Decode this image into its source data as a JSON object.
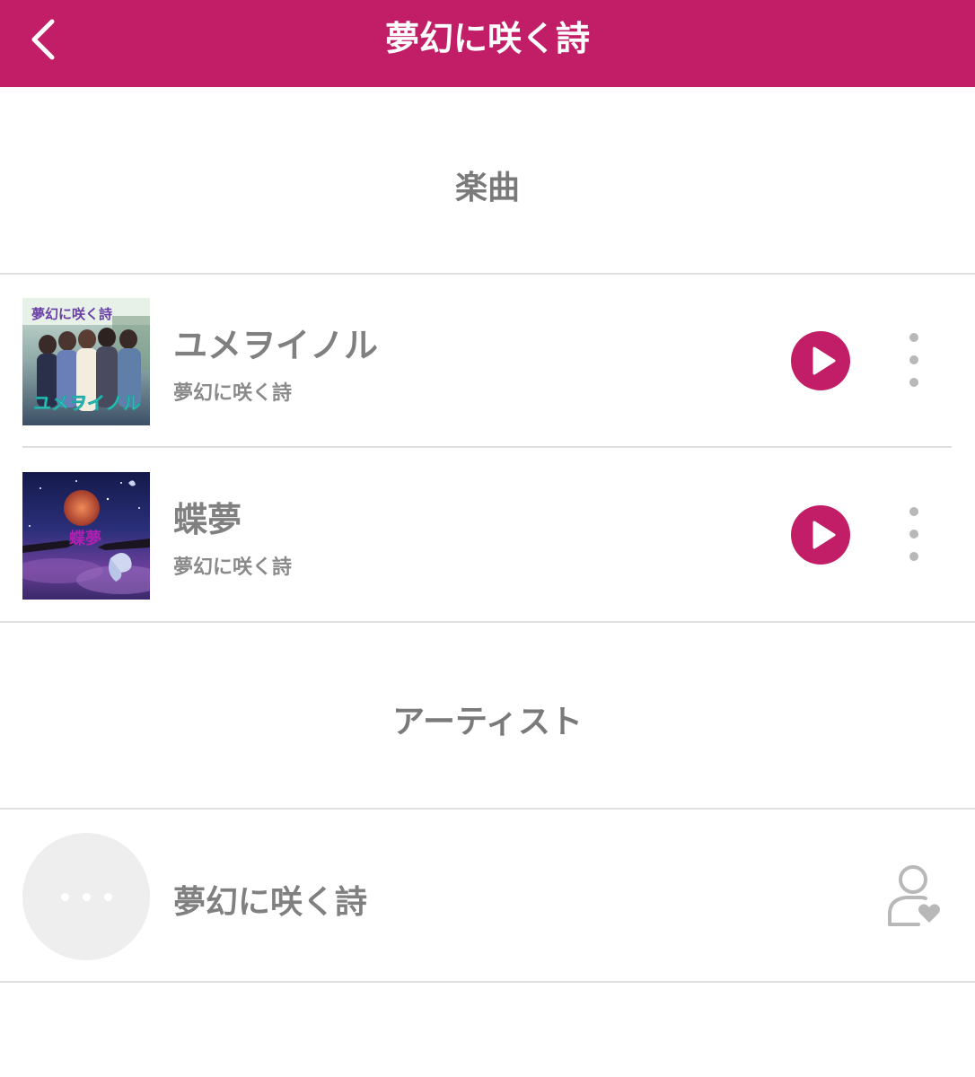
{
  "header": {
    "title": "夢幻に咲く詩",
    "back_icon": "chevron-left-icon",
    "background_color": "#c21e67"
  },
  "songs_section": {
    "heading": "楽曲",
    "items": [
      {
        "title": "ユメヲイノル",
        "artist": "夢幻に咲く詩",
        "jacket_title": "ユメヲイノル",
        "jacket_logo": "夢幻に咲く詩",
        "play_icon": "play-icon",
        "more_icon": "more-vertical-icon"
      },
      {
        "title": "蝶夢",
        "artist": "夢幻に咲く詩",
        "jacket_title": "蝶夢",
        "play_icon": "play-icon",
        "more_icon": "more-vertical-icon"
      }
    ]
  },
  "artists_section": {
    "heading": "アーティスト",
    "items": [
      {
        "name": "夢幻に咲く詩",
        "avatar_icon": "avatar-placeholder-icon",
        "follow_icon": "user-heart-icon"
      }
    ]
  },
  "colors": {
    "accent": "#c21e67",
    "text_gray": "#808080",
    "divider": "#e0e0e0",
    "icon_gray": "#b8b8b8"
  }
}
